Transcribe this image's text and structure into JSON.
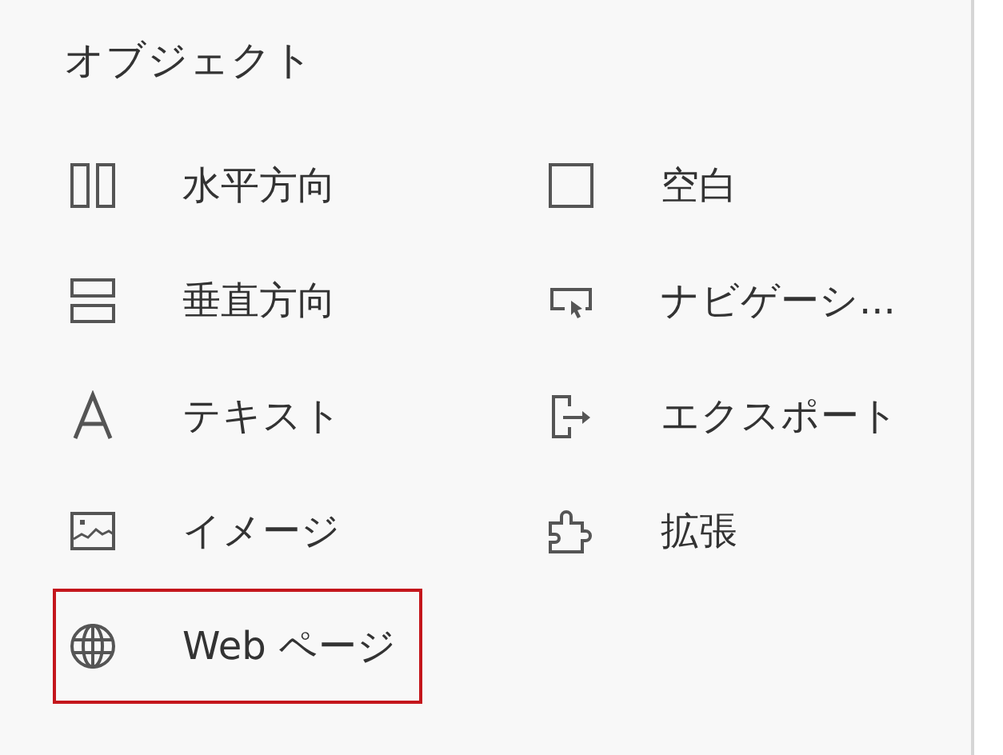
{
  "panel": {
    "title": "オブジェクト",
    "items": [
      {
        "kind": "horizontal",
        "label": "水平方向",
        "selected": false
      },
      {
        "kind": "blank",
        "label": "空白",
        "selected": false
      },
      {
        "kind": "vertical",
        "label": "垂直方向",
        "selected": false
      },
      {
        "kind": "navigation",
        "label": "ナビゲーシ...",
        "selected": false
      },
      {
        "kind": "text",
        "label": "テキスト",
        "selected": false
      },
      {
        "kind": "export",
        "label": "エクスポート",
        "selected": false
      },
      {
        "kind": "image",
        "label": "イメージ",
        "selected": false
      },
      {
        "kind": "extension",
        "label": "拡張",
        "selected": false
      },
      {
        "kind": "web",
        "label": "Web ページ",
        "selected": true
      }
    ]
  }
}
